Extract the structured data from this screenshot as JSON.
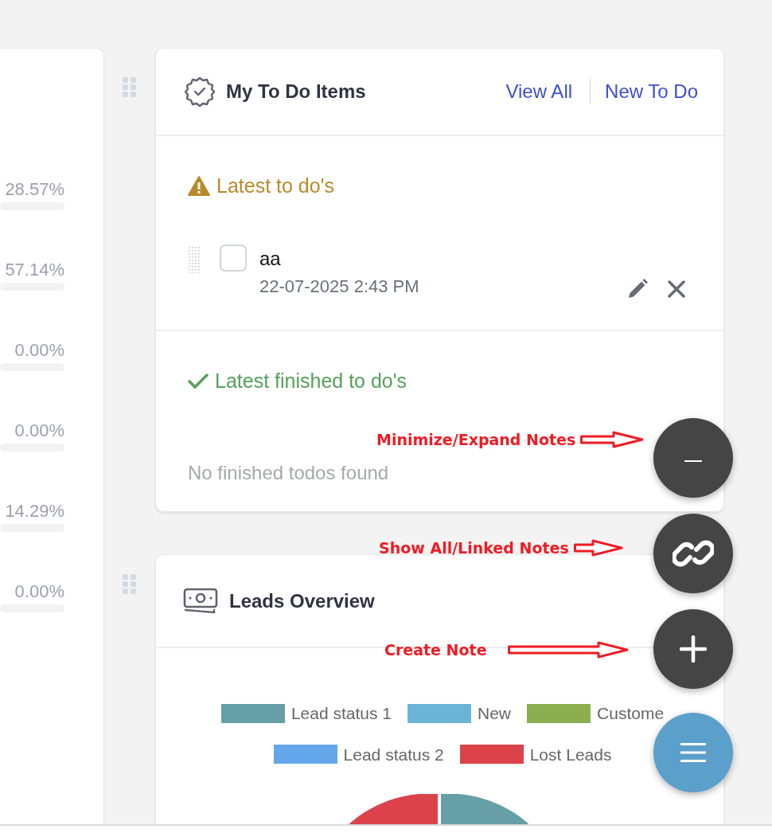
{
  "left_panel": {
    "rows": [
      {
        "reading": "28.57%"
      },
      {
        "reading": "57.14%"
      },
      {
        "reading": "0.00%"
      },
      {
        "reading": "0.00%"
      },
      {
        "reading": "14.29%"
      },
      {
        "reading": "0.00%"
      }
    ]
  },
  "todo_card": {
    "title": "My To Do Items",
    "links": [
      {
        "label": "View All"
      },
      {
        "label": "New To Do"
      }
    ],
    "sections": [
      {
        "kind": "pending",
        "heading": "Latest to do's",
        "items": [
          {
            "text": "aa",
            "date": "22-07-2025 2:43 PM",
            "checked": false
          }
        ]
      },
      {
        "kind": "finished",
        "heading": "Latest finished to do's",
        "empty_text": "No finished todos found"
      }
    ]
  },
  "leads_card": {
    "title": "Leads Overview",
    "legend": [
      {
        "label": "Lead status 1",
        "color": "#669fa6"
      },
      {
        "label": "New",
        "color": "#6cb4d6"
      },
      {
        "label": "Custome",
        "color": "#8aae50"
      },
      {
        "label": "Lead status 2",
        "color": "#63a6ea"
      },
      {
        "label": "Lost Leads",
        "color": "#dc4249"
      }
    ]
  },
  "fab_buttons": [
    {
      "kind": "minimize"
    },
    {
      "kind": "link"
    },
    {
      "kind": "add"
    },
    {
      "kind": "menu"
    }
  ],
  "annotations": [
    {
      "text": "Minimize/Expand Notes"
    },
    {
      "text": "Show All/Linked Notes"
    },
    {
      "text": "Create Note"
    }
  ]
}
